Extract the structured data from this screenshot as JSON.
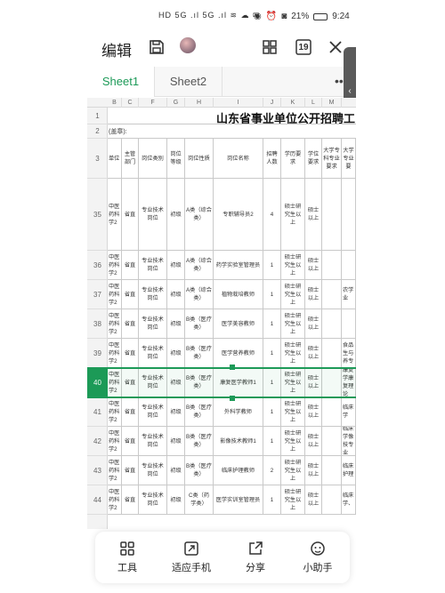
{
  "status_bar": {
    "left_text": "HD 5G .ıl 5G .ıl ≋ ☁ ✉",
    "battery": "21%",
    "time": "9:24"
  },
  "toolbar": {
    "edit_label": "编辑",
    "save_icon": "save-icon",
    "avatar": "avatar",
    "grid_icon": "grid-view-icon",
    "sheet_count_badge": "19",
    "close_icon": "close-icon"
  },
  "tabs": [
    {
      "label": "Sheet1",
      "active": true
    },
    {
      "label": "Sheet2",
      "active": false
    }
  ],
  "tabs_more": "••",
  "columns": [
    "B",
    "C",
    "F",
    "G",
    "H",
    "I",
    "J",
    "K",
    "L",
    "M"
  ],
  "title": "山东省事业单位公开招聘工",
  "row2": {
    "label": "(盖章):"
  },
  "header": {
    "b": "单位",
    "c": "主管部门",
    "f": "岗位类别",
    "g": "岗位等级",
    "h": "岗位性质",
    "i": "岗位名称",
    "j": "招聘人数",
    "k": "学历要求",
    "l": "学位要求",
    "m": "大学专科专业要求",
    "n": "大学专业要"
  },
  "rows": [
    {
      "num": "35",
      "b": "中医药科学2",
      "c": "省直",
      "f": "专业技术岗位",
      "g": "初级",
      "h": "A类（综合类）",
      "i": "专职辅导员2",
      "j": "4",
      "k": "硕士研究生以上",
      "l": "硕士以上",
      "m": "",
      "n": ""
    },
    {
      "num": "36",
      "b": "中医药科学2",
      "c": "省直",
      "f": "专业技术岗位",
      "g": "初级",
      "h": "A类（综合类）",
      "i": "药学实验室管理员",
      "j": "1",
      "k": "硕士研究生以上",
      "l": "硕士以上",
      "m": "",
      "n": ""
    },
    {
      "num": "37",
      "b": "中医药科学2",
      "c": "省直",
      "f": "专业技术岗位",
      "g": "初级",
      "h": "A类（综合类）",
      "i": "植物栽培教师",
      "j": "1",
      "k": "硕士研究生以上",
      "l": "硕士以上",
      "m": "",
      "n": "农学业"
    },
    {
      "num": "38",
      "b": "中医药科学2",
      "c": "省直",
      "f": "专业技术岗位",
      "g": "初级",
      "h": "B类（医疗类）",
      "i": "医学美容教师",
      "j": "1",
      "k": "硕士研究生以上",
      "l": "硕士以上",
      "m": "",
      "n": ""
    },
    {
      "num": "39",
      "b": "中医药科学2",
      "c": "省直",
      "f": "专业技术岗位",
      "g": "初级",
      "h": "B类（医疗类）",
      "i": "医学营养教师",
      "j": "1",
      "k": "硕士研究生以上",
      "l": "硕士以上",
      "m": "",
      "n": "食品生与养专"
    },
    {
      "num": "40",
      "b": "中医药科学2",
      "c": "省直",
      "f": "专业技术岗位",
      "g": "初级",
      "h": "B类（医疗类）",
      "i": "康复医学教师1",
      "j": "1",
      "k": "硕士研究生以上",
      "l": "硕士以上",
      "m": "",
      "n": "康复学康复理论"
    },
    {
      "num": "41",
      "b": "中医药科学2",
      "c": "省直",
      "f": "专业技术岗位",
      "g": "初级",
      "h": "B类（医疗类）",
      "i": "外科学教师",
      "j": "1",
      "k": "硕士研究生以上",
      "l": "硕士以上",
      "m": "",
      "n": "临床学"
    },
    {
      "num": "42",
      "b": "中医药科学2",
      "c": "省直",
      "f": "专业技术岗位",
      "g": "初级",
      "h": "B类（医疗类）",
      "i": "影像技术教师1",
      "j": "1",
      "k": "硕士研究生以上",
      "l": "硕士以上",
      "m": "",
      "n": "临床学像技专业"
    },
    {
      "num": "43",
      "b": "中医药科学2",
      "c": "省直",
      "f": "专业技术岗位",
      "g": "初级",
      "h": "B类（医疗类）",
      "i": "临床护理教师",
      "j": "2",
      "k": "硕士研究生以上",
      "l": "硕士以上",
      "m": "",
      "n": "临床护理"
    },
    {
      "num": "44",
      "b": "中医药科学2",
      "c": "省直",
      "f": "专业技术岗位",
      "g": "初级",
      "h": "C类（药学类）",
      "i": "医学实训室管理员",
      "j": "1",
      "k": "硕士研究生以上",
      "l": "硕士以上",
      "m": "",
      "n": "临床学、"
    }
  ],
  "bottom_bar": [
    {
      "label": "工具",
      "icon": "tools-icon"
    },
    {
      "label": "适应手机",
      "icon": "fit-screen-icon"
    },
    {
      "label": "分享",
      "icon": "share-icon"
    },
    {
      "label": "小助手",
      "icon": "assistant-icon"
    }
  ]
}
